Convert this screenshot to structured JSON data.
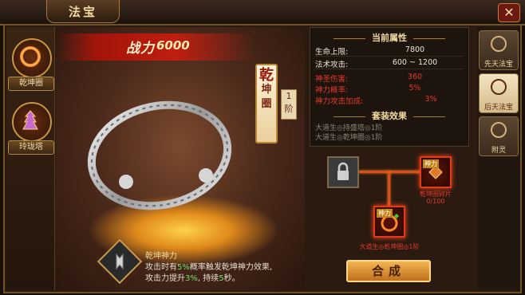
{
  "window": {
    "title": "法宝",
    "close_symbol": "✕"
  },
  "left_items": [
    {
      "label": "乾坤圈",
      "icon": "ring-icon"
    },
    {
      "label": "玲珑塔",
      "icon": "tower-icon"
    }
  ],
  "power": {
    "label": "战力",
    "value": "6000"
  },
  "item": {
    "name_chars": [
      "乾",
      "坤",
      "圈"
    ],
    "grade_num": "1",
    "grade_unit": "阶"
  },
  "attributes": {
    "title": "当前属性",
    "base": [
      {
        "key": "生命上限:",
        "value": "7800"
      },
      {
        "key": "法术攻击:",
        "value": "600 ~ 1200"
      }
    ],
    "special": [
      {
        "key": "神圣伤害:",
        "value": "360"
      },
      {
        "key": "神力概率:",
        "value": "5%"
      },
      {
        "key": "神力攻击加成:",
        "value": "3%"
      }
    ]
  },
  "set_effect": {
    "title": "套装效果",
    "lines": [
      "大道生◎持盛塔◎1阶",
      "大道生◎乾坤圈◎1阶"
    ]
  },
  "skill": {
    "name": "乾坤神力",
    "line1_pre": "攻击时有",
    "line1_hl": "5%",
    "line1_post": "概率触发乾坤神力效果,",
    "line2_pre": "攻击力提升",
    "line2_hl": "3%",
    "line2_mid": ", 持续",
    "line2_hl2": "5",
    "line2_post": "秒。"
  },
  "synth": {
    "frag_top_tag": "神力",
    "frag_top_label1": "乾坤圈碎片",
    "frag_top_label2": "0/100",
    "frag_bot_tag": "神力",
    "frag_bot_label": "大道生◎乾坤圈◎1阶",
    "compose_label": "合成"
  },
  "tabs": [
    {
      "label": "先天法宝",
      "active": false
    },
    {
      "label": "后天法宝",
      "active": true
    },
    {
      "label": "附灵",
      "active": false
    }
  ],
  "colors": {
    "accent_gold": "#f0d8a0",
    "attr_red": "#e23a2a",
    "highlight_green": "#6ee26e"
  }
}
